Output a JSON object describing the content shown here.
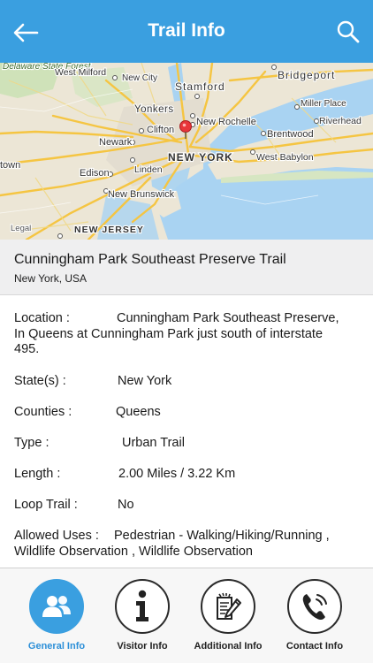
{
  "header": {
    "title": "Trail Info",
    "back_icon": "arrow-left-icon",
    "search_icon": "search-icon"
  },
  "map": {
    "labels": {
      "delaware_state_forest": "Delaware State Forest",
      "west_milford": "West Milford",
      "new_city": "New City",
      "stamford": "Stamford",
      "bridgeport": "Bridgeport",
      "miller_place": "Miller Place",
      "yonkers": "Yonkers",
      "new_rochelle": "New Rochelle",
      "riverhead": "Riverhead",
      "clifton": "Clifton",
      "brentwood": "Brentwood",
      "newark": "Newark",
      "new_york": "NEW YORK",
      "west_babylon": "West Babylon",
      "town": "town",
      "linden": "Linden",
      "edison": "Edison",
      "new_brunswick": "New Brunswick",
      "legal": "Legal",
      "new_jersey": "NEW JERSEY"
    },
    "pin_icon": "map-pin-icon"
  },
  "trail": {
    "name": "Cunningham Park Southeast Preserve Trail",
    "location": "New York, USA"
  },
  "details": {
    "location_label": "Location  :",
    "location_value": "Cunningham Park Southeast Preserve,",
    "location_more": "In Queens at Cunningham Park just south of interstate 495.",
    "state_label": "State(s)  :",
    "state_value": "New York",
    "counties_label": "Counties  :",
    "counties_value": "Queens",
    "type_label": "Type  :",
    "type_value": "Urban Trail",
    "length_label": "Length  :",
    "length_value": "2.00 Miles / 3.22 Km",
    "loop_label": "Loop Trail  :",
    "loop_value": "No",
    "uses_label": "Allowed Uses  :",
    "uses_value": "Pedestrian - Walking/Hiking/Running ,",
    "uses_more": "Wildlife Observation , Wildlife Observation"
  },
  "tabs": [
    {
      "label": "General Info",
      "icon": "users-icon",
      "active": true
    },
    {
      "label": "Visitor Info",
      "icon": "info-icon",
      "active": false
    },
    {
      "label": "Additional Info",
      "icon": "edit-document-icon",
      "active": false
    },
    {
      "label": "Contact Info",
      "icon": "phone-icon",
      "active": false
    }
  ],
  "colors": {
    "primary": "#3a9fe0",
    "water": "#a9d3f2",
    "land": "#e9e4d8",
    "highway": "#f5c542"
  }
}
